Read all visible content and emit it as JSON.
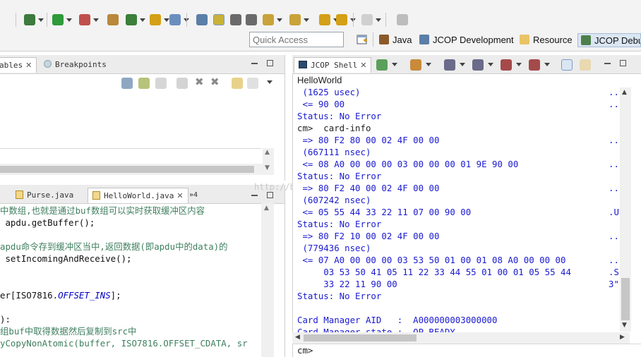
{
  "toolbar": {
    "icons": [
      "debug-icon",
      "run-icon",
      "coverage-icon",
      "external-tools-icon",
      "new-class-icon",
      "open-type-icon",
      "search-icon",
      "toggle-mark-occurrences-icon",
      "highlight-icon",
      "show-whitespace-icon",
      "block-selection-icon",
      "next-annotation-icon",
      "previous-annotation-icon",
      "last-edit-icon",
      "back-icon",
      "forward-icon",
      "pin-editor-icon"
    ]
  },
  "quick_access": {
    "placeholder": "Quick Access"
  },
  "perspectives": [
    {
      "label": "Java",
      "icon": "java-perspective-icon"
    },
    {
      "label": "JCOP Development",
      "icon": "jcop-development-icon"
    },
    {
      "label": "Resource",
      "icon": "resource-perspective-icon"
    },
    {
      "label": "JCOP Debug",
      "icon": "jcop-debug-icon",
      "active": true
    }
  ],
  "variables_panel": {
    "tabs": [
      {
        "label": "ables",
        "closable": true
      },
      {
        "label": "Breakpoints",
        "closable": false
      }
    ]
  },
  "editor": {
    "tabs": [
      {
        "label": "Purse.java",
        "active": false
      },
      {
        "label": "HelloWorld.java",
        "active": true,
        "closable": true
      }
    ],
    "overflow_label": "»4",
    "lines": [
      {
        "text": "中数组,也就是通过buf数组可以实时获取缓冲区内容",
        "cls": "cmt"
      },
      {
        "text": " apdu.getBuffer();",
        "cls": "code"
      },
      {
        "text": "",
        "cls": "code"
      },
      {
        "text": "apdu命令存到缓冲区当中,返回数据(即apdu中的data)的",
        "cls": "cmt"
      },
      {
        "text": " setIncomingAndReceive();",
        "cls": "code"
      },
      {
        "text": "",
        "cls": "code"
      },
      {
        "text": "",
        "cls": "code"
      },
      {
        "text": "er[ISO7816.",
        "cls": "code",
        "ital": "OFFSET_INS",
        "tail": "];"
      },
      {
        "text": "",
        "cls": "code"
      },
      {
        "text": "):",
        "cls": "code"
      },
      {
        "text": "组buf中取得数据然后复制到src中",
        "cls": "cmt"
      },
      {
        "text": "yCopyNonAtomic(buffer, ISO7816.OFFSET_CDATA, sr",
        "cls": "cmt"
      }
    ]
  },
  "shell": {
    "tab_label": "JCOP Shell",
    "title": "HelloWorld",
    "lines": [
      {
        "text": " (1625 usec)",
        "dark": false,
        "dots": ".."
      },
      {
        "text": " <= 90 00",
        "dark": false,
        "dots": ".."
      },
      {
        "text": "Status: No Error",
        "dark": false,
        "dots": ""
      },
      {
        "text": "cm>  card-info",
        "dark": true,
        "dots": ""
      },
      {
        "text": " => 80 F2 80 00 02 4F 00 00",
        "dark": false,
        "dots": ".."
      },
      {
        "text": " (667111 nsec)",
        "dark": false,
        "dots": ""
      },
      {
        "text": " <= 08 A0 00 00 00 03 00 00 00 01 9E 90 00",
        "dark": false,
        "dots": ".."
      },
      {
        "text": "Status: No Error",
        "dark": false,
        "dots": ""
      },
      {
        "text": " => 80 F2 40 00 02 4F 00 00",
        "dark": false,
        "dots": ".."
      },
      {
        "text": " (607242 nsec)",
        "dark": false,
        "dots": ""
      },
      {
        "text": " <= 05 55 44 33 22 11 07 00 90 00",
        "dark": false,
        "dots": ".U"
      },
      {
        "text": "Status: No Error",
        "dark": false,
        "dots": ""
      },
      {
        "text": " => 80 F2 10 00 02 4F 00 00",
        "dark": false,
        "dots": ".."
      },
      {
        "text": " (779436 nsec)",
        "dark": false,
        "dots": ""
      },
      {
        "text": " <= 07 A0 00 00 00 03 53 50 01 00 01 08 A0 00 00 00",
        "dark": false,
        "dots": ".."
      },
      {
        "text": "     03 53 50 41 05 11 22 33 44 55 01 00 01 05 55 44",
        "dark": false,
        "dots": ".S"
      },
      {
        "text": "     33 22 11 90 00",
        "dark": false,
        "dots": "3\""
      },
      {
        "text": "Status: No Error",
        "dark": false,
        "dots": ""
      },
      {
        "text": "",
        "dark": false,
        "dots": ""
      },
      {
        "text": "Card Manager AID   :  A000000003000000",
        "dark": false,
        "dots": ""
      },
      {
        "text": "Card Manager state :  OP_READY",
        "dark": false,
        "dots": ""
      }
    ],
    "prompt": "cm>"
  },
  "watermark": "http://blog.csdn.net/"
}
